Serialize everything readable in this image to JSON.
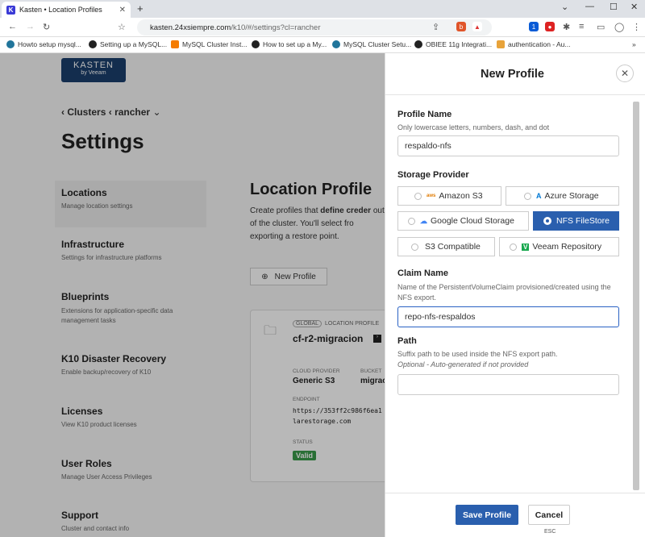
{
  "browser": {
    "tab_title": "Kasten • Location Profiles",
    "tab_favicon": "K",
    "url_host": "kasten.24xsiempre.com",
    "url_path": "/k10/#/settings?cl=rancher",
    "bookmarks": [
      "Howto setup mysql...",
      "Setting up a MySQL...",
      "MySQL Cluster Inst...",
      "How to set up a My...",
      "MySQL Cluster Setu...",
      "OBIEE 11g Integrati...",
      "authentication - Au..."
    ]
  },
  "logo": {
    "line1": "KASTEN",
    "line2": "by Veeam"
  },
  "breadcrumb": {
    "clusters": "Clusters",
    "cluster": "rancher"
  },
  "page_title": "Settings",
  "nav": [
    {
      "label": "Locations",
      "sub": "Manage location settings"
    },
    {
      "label": "Infrastructure",
      "sub": "Settings for infrastructure platforms"
    },
    {
      "label": "Blueprints",
      "sub": "Extensions for application-specific data management tasks"
    },
    {
      "label": "K10 Disaster Recovery",
      "sub": "Enable backup/recovery of K10"
    },
    {
      "label": "Licenses",
      "sub": "View K10 product licenses"
    },
    {
      "label": "User Roles",
      "sub": "Manage User Access Privileges"
    },
    {
      "label": "Support",
      "sub": "Cluster and contact info"
    }
  ],
  "main": {
    "title": "Location Profile",
    "desc_a": "Create profiles that ",
    "desc_bold": "define creder",
    "desc_b": " out of the cluster. You'll select fro exporting a restore point.",
    "new_profile": "New Profile",
    "card": {
      "badge_global": "GLOBAL",
      "badge_type": "LOCATION PROFILE",
      "name": "cf-r2-migracion",
      "provider_label": "CLOUD PROVIDER",
      "provider": "Generic S3",
      "bucket_label": "BUCKET",
      "bucket": "migrac",
      "endpoint_label": "ENDPOINT",
      "endpoint": "https://353ff2c986f6ea1 dflarestorage.com",
      "status_label": "STATUS",
      "status": "Valid"
    }
  },
  "panel": {
    "title": "New Profile",
    "profile_name_label": "Profile Name",
    "profile_name_hint": "Only lowercase letters, numbers, dash, and dot",
    "profile_name_value": "respaldo-nfs",
    "storage_label": "Storage Provider",
    "providers": [
      {
        "label": "Amazon S3",
        "icon": "aws-icon",
        "selected": false
      },
      {
        "label": "Azure Storage",
        "icon": "azure-icon",
        "selected": false
      },
      {
        "label": "Google Cloud Storage",
        "icon": "gcp-icon",
        "selected": false
      },
      {
        "label": "NFS FileStore",
        "icon": "nfs-icon",
        "selected": true
      },
      {
        "label": "S3 Compatible",
        "icon": "",
        "selected": false
      },
      {
        "label": "Veeam Repository",
        "icon": "veeam-icon",
        "selected": false
      }
    ],
    "claim_label": "Claim Name",
    "claim_hint": "Name of the PersistentVolumeClaim provisioned/created using the NFS export.",
    "claim_value": "repo-nfs-respaldos",
    "path_label": "Path",
    "path_hint": "Suffix path to be used inside the NFS export path.",
    "path_optional": "Optional - Auto-generated if not provided",
    "path_value": "",
    "save": "Save Profile",
    "cancel": "Cancel",
    "esc": "ESC"
  },
  "colors": {
    "primary": "#2a5fae",
    "logo_bg": "#1b3f6d",
    "valid": "#3a9a4a"
  }
}
